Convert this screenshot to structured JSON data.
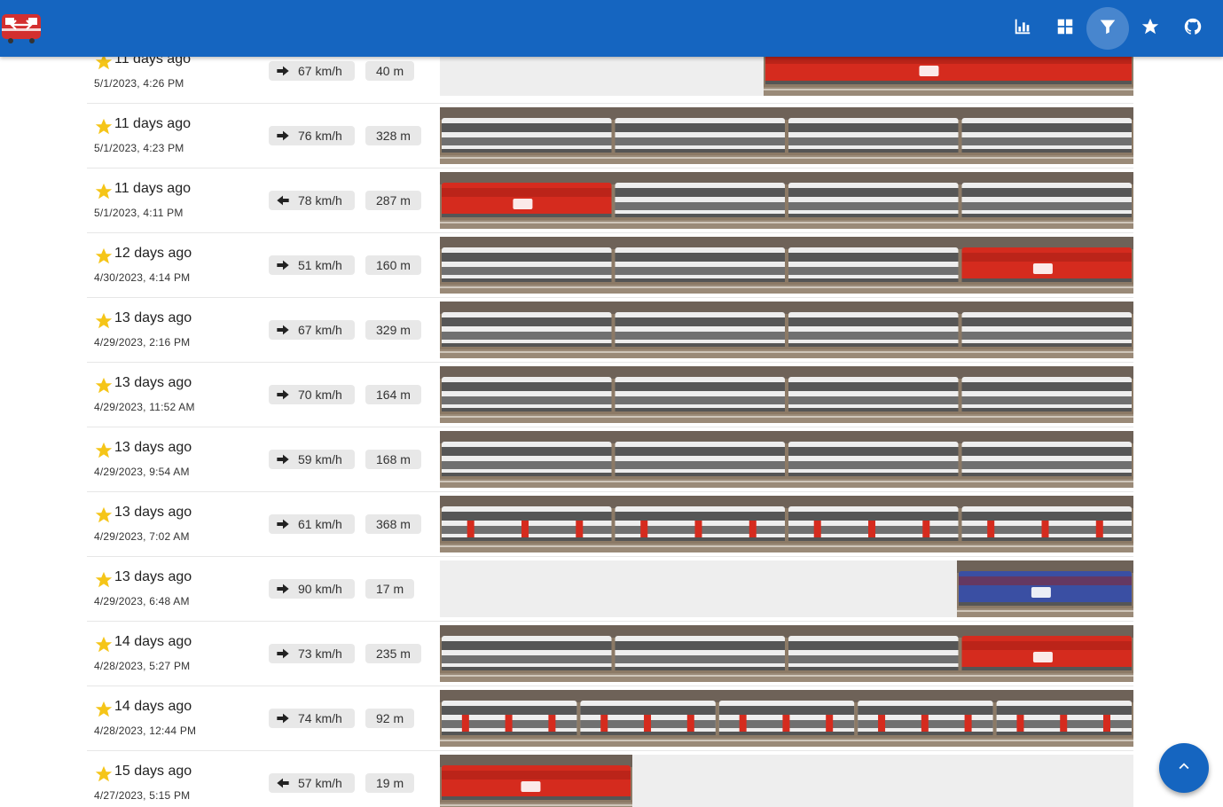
{
  "app": {
    "logo_icon": "sbb-locomotive-logo-icon",
    "brand_color": "#1565c0",
    "nav": [
      {
        "icon": "bar-chart-icon",
        "label": "Statistics",
        "active": false
      },
      {
        "icon": "grid-view-icon",
        "label": "Gallery",
        "active": false
      },
      {
        "icon": "filter-icon",
        "label": "Filter",
        "active": true
      },
      {
        "icon": "star-icon",
        "label": "Favorites",
        "active": false
      },
      {
        "icon": "github-icon",
        "label": "GitHub",
        "active": false
      }
    ]
  },
  "trains": [
    {
      "ago": "11 days ago",
      "timestamp": "5/1/2023, 4:26 PM",
      "direction": "right",
      "speed": "67 km/h",
      "length": "40 m",
      "starred": true
    },
    {
      "ago": "11 days ago",
      "timestamp": "5/1/2023, 4:23 PM",
      "direction": "right",
      "speed": "76 km/h",
      "length": "328 m",
      "starred": true
    },
    {
      "ago": "11 days ago",
      "timestamp": "5/1/2023, 4:11 PM",
      "direction": "left",
      "speed": "78 km/h",
      "length": "287 m",
      "starred": true
    },
    {
      "ago": "12 days ago",
      "timestamp": "4/30/2023, 4:14 PM",
      "direction": "right",
      "speed": "51 km/h",
      "length": "160 m",
      "starred": true
    },
    {
      "ago": "13 days ago",
      "timestamp": "4/29/2023, 2:16 PM",
      "direction": "right",
      "speed": "67 km/h",
      "length": "329 m",
      "starred": true
    },
    {
      "ago": "13 days ago",
      "timestamp": "4/29/2023, 11:52 AM",
      "direction": "right",
      "speed": "70 km/h",
      "length": "164 m",
      "starred": true
    },
    {
      "ago": "13 days ago",
      "timestamp": "4/29/2023, 9:54 AM",
      "direction": "right",
      "speed": "59 km/h",
      "length": "168 m",
      "starred": true
    },
    {
      "ago": "13 days ago",
      "timestamp": "4/29/2023, 7:02 AM",
      "direction": "right",
      "speed": "61 km/h",
      "length": "368 m",
      "starred": true
    },
    {
      "ago": "13 days ago",
      "timestamp": "4/29/2023, 6:48 AM",
      "direction": "right",
      "speed": "90 km/h",
      "length": "17 m",
      "starred": true
    },
    {
      "ago": "14 days ago",
      "timestamp": "4/28/2023, 5:27 PM",
      "direction": "right",
      "speed": "73 km/h",
      "length": "235 m",
      "starred": true
    },
    {
      "ago": "14 days ago",
      "timestamp": "4/28/2023, 12:44 PM",
      "direction": "right",
      "speed": "74 km/h",
      "length": "92 m",
      "starred": true
    },
    {
      "ago": "15 days ago",
      "timestamp": "4/27/2023, 5:15 PM",
      "direction": "left",
      "speed": "57 km/h",
      "length": "19 m",
      "starred": true
    }
  ],
  "scroll_top_icon": "chevron-up-icon"
}
